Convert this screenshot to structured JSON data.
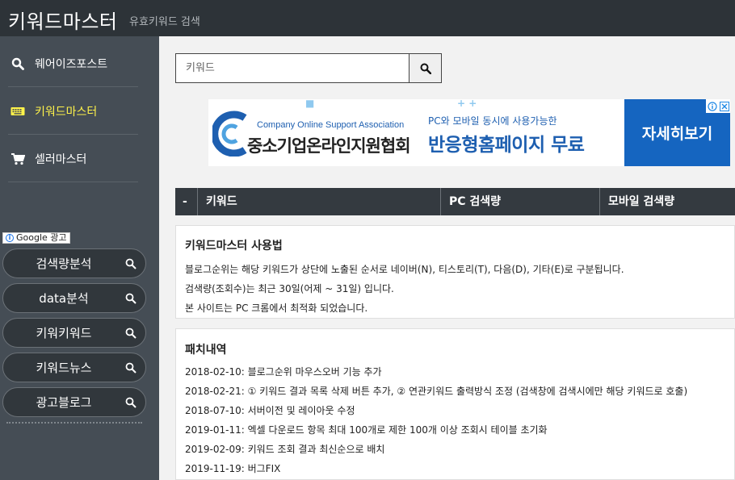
{
  "header": {
    "brand": "키워드마스터",
    "subtitle": "유효키워드 검색"
  },
  "sidebar": {
    "items": [
      {
        "label": "웨어이즈포스트",
        "icon": "search-icon",
        "active": false
      },
      {
        "label": "키워드마스터",
        "icon": "keyboard-icon",
        "active": true
      },
      {
        "label": "셀러마스터",
        "icon": "cart-icon",
        "active": false
      }
    ],
    "ad_label": "Google 광고",
    "ad_links": [
      "검색량분석",
      "data분석",
      "키워키워드",
      "키워드뉴스",
      "광고블로그"
    ]
  },
  "search": {
    "placeholder": "키워드",
    "value": ""
  },
  "banner": {
    "org_en": "Company Online Support Association",
    "org_kr": "중소기업온라인지원협회",
    "tagline": "PC와 모바일 동시에 사용가능한",
    "headline": "반응형홈페이지 무료",
    "cta": "자세히보기"
  },
  "table": {
    "columns": [
      "-",
      "키워드",
      "PC 검색량",
      "모바일 검색량"
    ]
  },
  "usage": {
    "title": "키워드마스터 사용법",
    "lines": [
      "블로그순위는 해당 키워드가 상단에 노출된 순서로 네이버(N), 티스토리(T), 다음(D), 기타(E)로 구분됩니다.",
      "검색량(조회수)는 최근 30일(어제 ~ 31일) 입니다.",
      "본 사이트는 PC 크롬에서 최적화 되었습니다."
    ]
  },
  "patch": {
    "title": "패치내역",
    "lines": [
      "2018-02-10: 블로그순위 마우스오버 기능 추가",
      "2018-02-21: ① 키워드 결과 목록 삭제 버튼 추가, ② 연관키워드 출력방식 조정 (검색창에 검색시에만 해당 키워드로 호출)",
      "2018-07-10: 서버이전 및 레이아웃 수정",
      "2019-01-11: 엑셀 다운로드 항목 최대 100개로 제한 100개 이상 조회시 테이블 초기화",
      "2019-02-09: 키워드 조회 결과 최신순으로 배치",
      "2019-11-19: 버그FIX"
    ]
  },
  "colors": {
    "header_bg": "#2d3338",
    "sidebar_bg": "#454d55",
    "active": "#fff34a",
    "banner_blue": "#1565c0"
  }
}
